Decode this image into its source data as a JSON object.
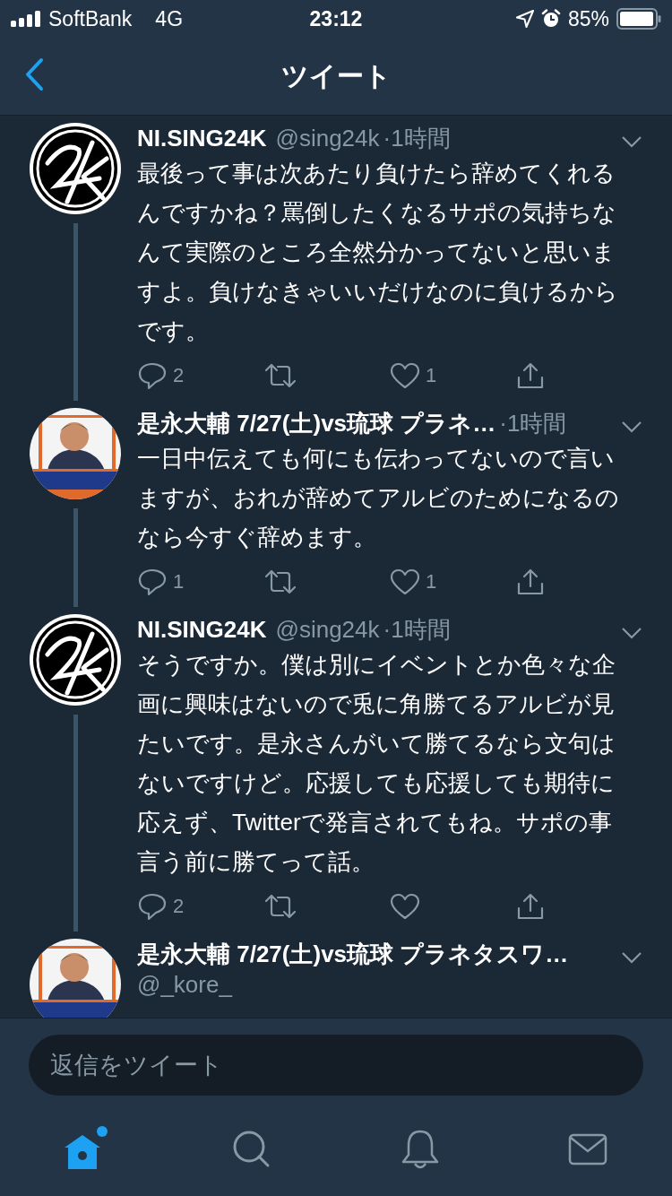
{
  "status_bar": {
    "carrier": "SoftBank",
    "network": "4G",
    "time": "23:12",
    "battery": "85%"
  },
  "nav": {
    "title": "ツイート"
  },
  "tweets": [
    {
      "avatar": {
        "kind": "logo"
      },
      "name": "NI.SING24K",
      "handle": "@sing24k",
      "time": "·1時間",
      "text": "最後って事は次あたり負けたら辞めてくれるんですかね？罵倒したくなるサポの気持ちなんて実際のところ全然分かってないと思いますよ。負けなきゃいいだけなのに負けるからです。",
      "replies": "2",
      "likes": "1"
    },
    {
      "name": "是永大輔 7/27(土)vs琉球 プラネ…",
      "time": "·1時間",
      "text": "一日中伝えても何にも伝わってないので言いますが、おれが辞めてアルビのためになるのなら今すぐ辞めます。",
      "replies": "1",
      "likes": "1"
    },
    {
      "avatar": {
        "kind": "logo"
      },
      "name": "NI.SING24K",
      "handle": "@sing24k",
      "time": "·1時間",
      "text": "そうですか。僕は別にイベントとか色々な企画に興味はないので兎に角勝てるアルビが見たいです。是永さんがいて勝てるなら文句はないですけど。応援しても応援しても期待に応えず、Twitterで発言されてもね。サポの事言う前に勝てって話。",
      "replies": "2"
    },
    {
      "name": "是永大輔 7/27(土)vs琉球 プラネタスワ…",
      "handle": "@_kore_"
    }
  ],
  "reply_field": {
    "placeholder": "返信をツイート"
  },
  "tab_bar": [
    {
      "kind": "home",
      "selected": true,
      "unread": true
    },
    {
      "kind": "search",
      "selected": false,
      "unread": false
    },
    {
      "kind": "notifications",
      "selected": false,
      "unread": false
    },
    {
      "kind": "messages",
      "selected": false,
      "unread": false
    }
  ]
}
